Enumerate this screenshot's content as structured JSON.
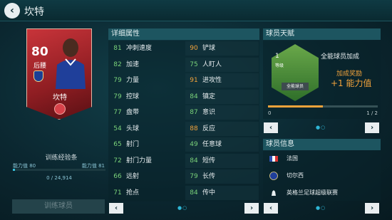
{
  "header": {
    "title": "坎特"
  },
  "card": {
    "rating": "80",
    "position": "后腰",
    "name": "坎特"
  },
  "training": {
    "bar_title": "训练经验条",
    "left_label": "能力值 80",
    "right_label": "能力值 81",
    "progress_text": "0 / 24,914",
    "progress": 0,
    "button_label": "训练球员"
  },
  "attributes": {
    "title": "详细属性",
    "left": [
      {
        "value": "81",
        "name": "冲刺速度"
      },
      {
        "value": "82",
        "name": "加速"
      },
      {
        "value": "79",
        "name": "力量"
      },
      {
        "value": "79",
        "name": "控球"
      },
      {
        "value": "77",
        "name": "盘带"
      },
      {
        "value": "54",
        "name": "头球"
      },
      {
        "value": "65",
        "name": "射门"
      },
      {
        "value": "72",
        "name": "射门力量"
      },
      {
        "value": "66",
        "name": "远射"
      },
      {
        "value": "71",
        "name": "抢点"
      }
    ],
    "right": [
      {
        "value": "90",
        "name": "铲球"
      },
      {
        "value": "75",
        "name": "人盯人"
      },
      {
        "value": "91",
        "name": "进攻性"
      },
      {
        "value": "84",
        "name": "镇定"
      },
      {
        "value": "87",
        "name": "意识"
      },
      {
        "value": "88",
        "name": "反应"
      },
      {
        "value": "49",
        "name": "任意球"
      },
      {
        "value": "84",
        "name": "短传"
      },
      {
        "value": "79",
        "name": "长传"
      },
      {
        "value": "84",
        "name": "传中"
      }
    ]
  },
  "talent": {
    "title": "球员天赋",
    "level": "1",
    "level_label": "等级",
    "tag": "全能球员",
    "name": "全能球员加成",
    "bonus_label": "加成奖励",
    "bonus_value": "+1 能力值",
    "count_left": "0",
    "count_ratio": "1 / 2",
    "progress": 0.5
  },
  "info": {
    "title": "球员信息",
    "nationality": "法国",
    "club": "切尔西",
    "league": "英格兰足球超级联赛"
  },
  "nav": {
    "prev": "‹",
    "next": "›",
    "dots": "●○"
  },
  "colors": {
    "accent": "#2fb6d6",
    "orange": "#f2a33b",
    "green": "#7ad27a",
    "card_red": "#c8343a"
  }
}
